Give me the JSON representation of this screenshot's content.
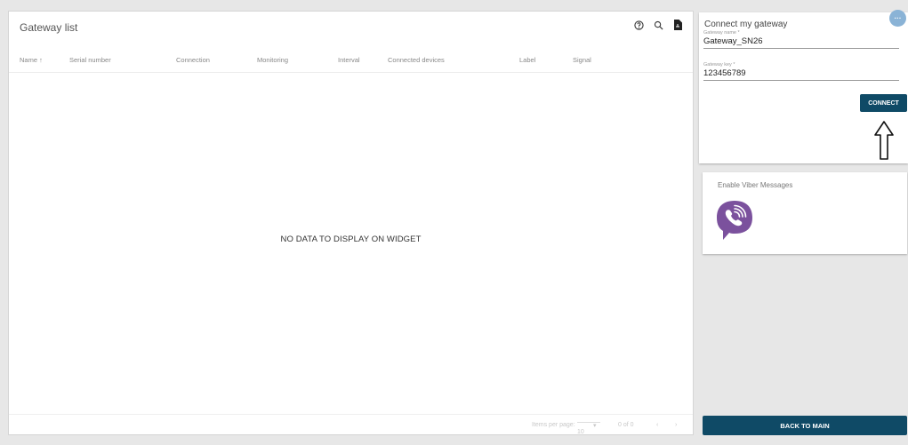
{
  "gateway_list": {
    "title": "Gateway list",
    "columns": [
      "Name ↑",
      "Serial number",
      "Connection",
      "Monitoring",
      "Interval",
      "Connected devices",
      "Label",
      "Signal"
    ],
    "empty_message": "NO DATA TO DISPLAY ON WIDGET",
    "pager": {
      "items_per_page_label": "Items per page:",
      "items_per_page_value": "10",
      "range": "0 of 0"
    }
  },
  "connect_card": {
    "title": "Connect my gateway",
    "gateway_name_label": "Gateway name *",
    "gateway_name_value": "Gateway_SN26",
    "gateway_key_label": "Gateway key *",
    "gateway_key_value": "123456789",
    "connect_label": "CONNECT"
  },
  "more_button_label": "···",
  "viber_card": {
    "title": "Enable Viber Messages"
  },
  "back_label": "BACK TO MAIN",
  "colors": {
    "accent": "#0f4a66",
    "viber": "#7b519d"
  }
}
